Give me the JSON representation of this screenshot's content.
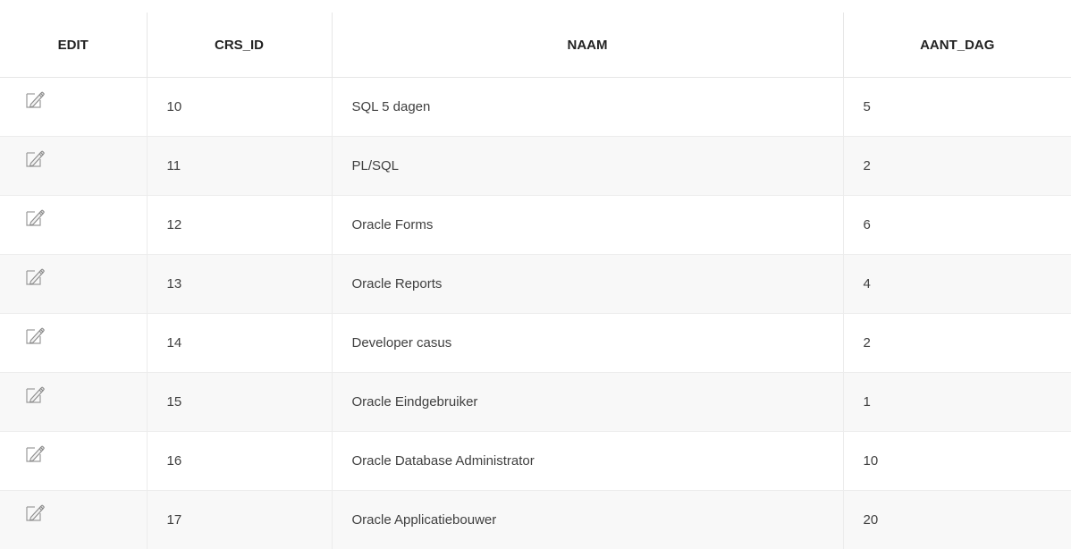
{
  "table": {
    "columns": [
      "EDIT",
      "CRS_ID",
      "NAAM",
      "AANT_DAG"
    ],
    "rows": [
      {
        "crs_id": "10",
        "naam": "SQL 5 dagen",
        "aant_dag": "5"
      },
      {
        "crs_id": "11",
        "naam": "PL/SQL",
        "aant_dag": "2"
      },
      {
        "crs_id": "12",
        "naam": "Oracle Forms",
        "aant_dag": "6"
      },
      {
        "crs_id": "13",
        "naam": "Oracle Reports",
        "aant_dag": "4"
      },
      {
        "crs_id": "14",
        "naam": "Developer casus",
        "aant_dag": "2"
      },
      {
        "crs_id": "15",
        "naam": "Oracle Eindgebruiker",
        "aant_dag": "1"
      },
      {
        "crs_id": "16",
        "naam": "Oracle Database Administrator",
        "aant_dag": "10"
      },
      {
        "crs_id": "17",
        "naam": "Oracle Applicatiebouwer",
        "aant_dag": "20"
      }
    ],
    "edit_icon": "edit-pencil-icon"
  },
  "colors": {
    "header_text": "#222222",
    "cell_text": "#404040",
    "row_stripe": "#f8f8f8",
    "border": "#ececec"
  }
}
